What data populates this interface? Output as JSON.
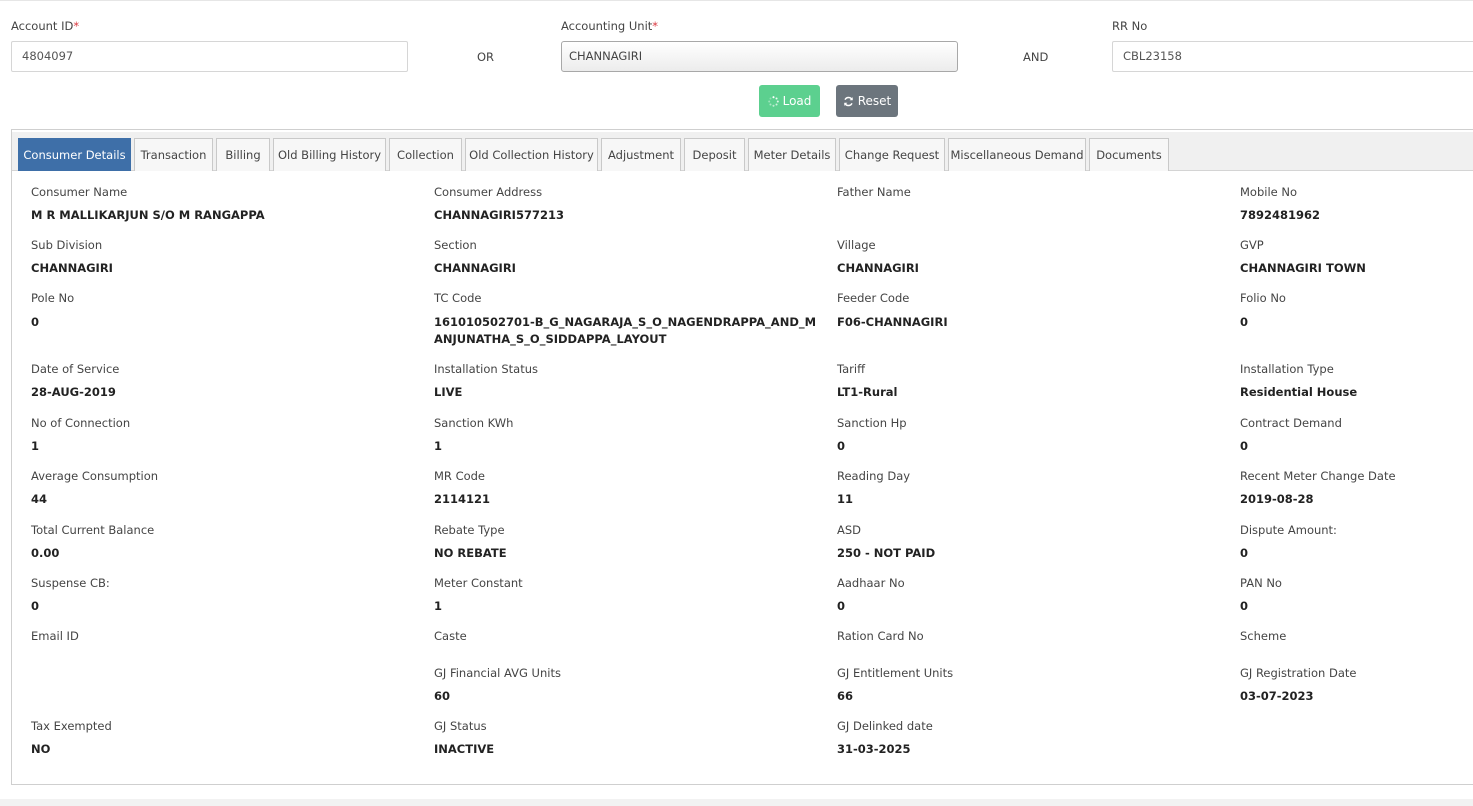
{
  "search": {
    "account_id_label": "Account ID",
    "account_id_value": "4804097",
    "or_label": "OR",
    "accounting_unit_label": "Accounting Unit",
    "accounting_unit_value": "CHANNAGIRI",
    "and_label": "AND",
    "rr_no_label": "RR No",
    "rr_no_value": "CBL23158",
    "required_mark": "*"
  },
  "buttons": {
    "load_label": "Load",
    "load_icon": "spinner-icon",
    "reset_label": "Reset",
    "reset_icon": "refresh-icon",
    "load_color": "#5cd08f",
    "reset_color": "#6c757d"
  },
  "tabs": [
    {
      "label": "Consumer Details",
      "active": true
    },
    {
      "label": "Transaction"
    },
    {
      "label": "Billing"
    },
    {
      "label": "Old Billing History"
    },
    {
      "label": "Collection"
    },
    {
      "label": "Old Collection History"
    },
    {
      "label": "Adjustment"
    },
    {
      "label": "Deposit"
    },
    {
      "label": "Meter Details"
    },
    {
      "label": "Change Request"
    },
    {
      "label": "Miscellaneous Demand"
    },
    {
      "label": "Documents"
    }
  ],
  "accent_color": "#3e6fa8",
  "details": {
    "consumer_name": {
      "label": "Consumer Name",
      "value": "M R MALLIKARJUN S/O M RANGAPPA"
    },
    "consumer_address": {
      "label": "Consumer Address",
      "value": "CHANNAGIRI577213"
    },
    "father_name": {
      "label": "Father Name",
      "value": ""
    },
    "mobile_no": {
      "label": "Mobile No",
      "value": "7892481962"
    },
    "sub_division": {
      "label": "Sub Division",
      "value": "CHANNAGIRI"
    },
    "section": {
      "label": "Section",
      "value": "CHANNAGIRI"
    },
    "village": {
      "label": "Village",
      "value": "CHANNAGIRI"
    },
    "gvp": {
      "label": "GVP",
      "value": "CHANNAGIRI TOWN"
    },
    "pole_no": {
      "label": "Pole No",
      "value": "0"
    },
    "tc_code": {
      "label": "TC Code",
      "value": "161010502701-B_G_NAGARAJA_S_O_NAGENDRAPPA_AND_MANJUNATHA_S_O_SIDDAPPA_LAYOUT"
    },
    "feeder_code": {
      "label": "Feeder Code",
      "value": "F06-CHANNAGIRI"
    },
    "folio_no": {
      "label": "Folio No",
      "value": "0"
    },
    "date_of_service": {
      "label": "Date of Service",
      "value": "28-AUG-2019"
    },
    "installation_status": {
      "label": "Installation Status",
      "value": "LIVE"
    },
    "tariff": {
      "label": "Tariff",
      "value": "LT1-Rural"
    },
    "installation_type": {
      "label": "Installation Type",
      "value": "Residential House"
    },
    "no_of_connection": {
      "label": "No of Connection",
      "value": "1"
    },
    "sanction_kwh": {
      "label": "Sanction KWh",
      "value": "1"
    },
    "sanction_hp": {
      "label": "Sanction Hp",
      "value": "0"
    },
    "contract_demand": {
      "label": "Contract Demand",
      "value": "0"
    },
    "average_consumption": {
      "label": "Average Consumption",
      "value": "44"
    },
    "mr_code": {
      "label": "MR Code",
      "value": "2114121"
    },
    "reading_day": {
      "label": "Reading Day",
      "value": "11"
    },
    "recent_meter_change_date": {
      "label": "Recent Meter Change Date",
      "value": "2019-08-28"
    },
    "total_current_balance": {
      "label": "Total Current Balance",
      "value": "0.00"
    },
    "rebate_type": {
      "label": "Rebate Type",
      "value": "NO REBATE"
    },
    "asd": {
      "label": "ASD",
      "value": "250 - NOT PAID"
    },
    "dispute_amount": {
      "label": "Dispute Amount:",
      "value": "0"
    },
    "suspense_cb": {
      "label": "Suspense CB:",
      "value": "0"
    },
    "meter_constant": {
      "label": "Meter Constant",
      "value": "1"
    },
    "aadhaar_no": {
      "label": "Aadhaar No",
      "value": "0"
    },
    "pan_no": {
      "label": "PAN No",
      "value": "0"
    },
    "email_id": {
      "label": "Email ID",
      "value": ""
    },
    "caste": {
      "label": "Caste",
      "value": ""
    },
    "ration_card_no": {
      "label": "Ration Card No",
      "value": ""
    },
    "scheme": {
      "label": "Scheme",
      "value": ""
    },
    "gj_financial_avg_units": {
      "label": "GJ Financial AVG Units",
      "value": "60"
    },
    "gj_entitlement_units": {
      "label": "GJ Entitlement Units",
      "value": "66"
    },
    "gj_registration_date": {
      "label": "GJ Registration Date",
      "value": "03-07-2023"
    },
    "tax_exempted": {
      "label": "Tax Exempted",
      "value": "NO"
    },
    "gj_status": {
      "label": "GJ Status",
      "value": "INACTIVE"
    },
    "gj_delinked_date": {
      "label": "GJ Delinked date",
      "value": "31-03-2025"
    }
  }
}
